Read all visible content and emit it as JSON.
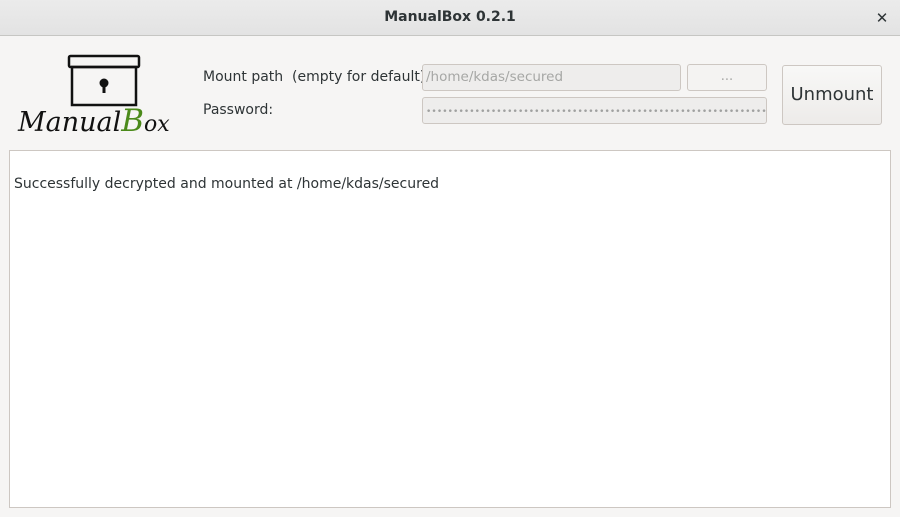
{
  "window": {
    "title": "ManualBox 0.2.1",
    "close_symbol": "✕"
  },
  "logo": {
    "text_part1": "Manual",
    "text_part2": "B",
    "text_part3": "ox",
    "accent_color": "#4b8a1a"
  },
  "form": {
    "mount_label": "Mount path  (empty for default):",
    "mount_value": "/home/kdas/secured",
    "browse_label": "...",
    "password_label": "Password:",
    "password_mask": "••••••••••••••••••••••••••••••••••••••••••••••••••••••••••••••••"
  },
  "actions": {
    "unmount_label": "Unmount"
  },
  "log": {
    "message": "Successfully decrypted and mounted at /home/kdas/secured"
  },
  "icons": {
    "logo": "lock-box-icon",
    "close": "close-icon"
  }
}
